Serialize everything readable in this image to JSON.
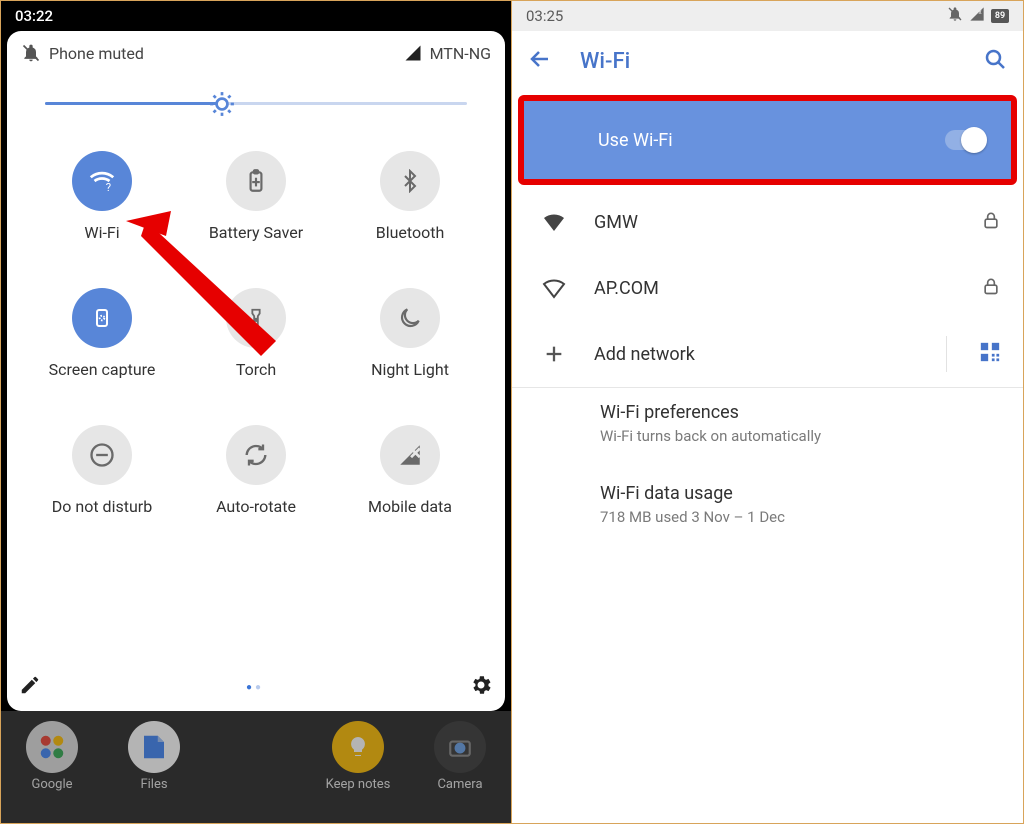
{
  "left": {
    "time": "03:22",
    "status_label": "Phone muted",
    "carrier": "MTN-NG",
    "brightness_pct": 42,
    "tiles": [
      {
        "id": "wifi",
        "label": "Wi-Fi",
        "on": true
      },
      {
        "id": "battery_saver",
        "label": "Battery Saver",
        "on": false
      },
      {
        "id": "bluetooth",
        "label": "Bluetooth",
        "on": false
      },
      {
        "id": "screen_capture",
        "label": "Screen capture",
        "on": true
      },
      {
        "id": "torch",
        "label": "Torch",
        "on": false
      },
      {
        "id": "night_light",
        "label": "Night Light",
        "on": false
      },
      {
        "id": "dnd",
        "label": "Do not disturb",
        "on": false
      },
      {
        "id": "autorotate",
        "label": "Auto-rotate",
        "on": false
      },
      {
        "id": "mobiledata",
        "label": "Mobile data",
        "on": false
      }
    ],
    "apps": [
      {
        "label": "Google"
      },
      {
        "label": "Files"
      },
      {
        "label": "Keep notes"
      },
      {
        "label": "Camera"
      }
    ]
  },
  "right": {
    "time": "03:25",
    "battery": "89",
    "title": "Wi-Fi",
    "use_wifi_label": "Use Wi-Fi",
    "use_wifi_on": true,
    "networks": [
      {
        "name": "GMW",
        "signal": "full",
        "secured": true
      },
      {
        "name": "AP.COM",
        "signal": "low",
        "secured": true
      }
    ],
    "add_network": "Add network",
    "pref_title": "Wi-Fi preferences",
    "pref_sub": "Wi-Fi turns back on automatically",
    "usage_title": "Wi-Fi data usage",
    "usage_sub": "718 MB used 3 Nov – 1 Dec"
  }
}
